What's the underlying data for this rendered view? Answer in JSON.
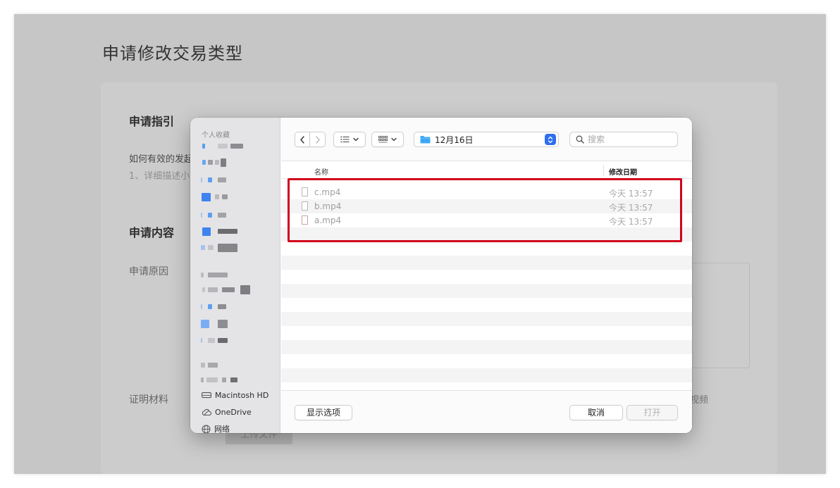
{
  "page": {
    "title": "申请修改交易类型",
    "guide_heading": "申请指引",
    "guide_text": "如何有效的发起",
    "guide_sub": "1、详细描述小",
    "content_heading": "申请内容",
    "reason_label": "申请原因",
    "proof_label": "证明材料",
    "proof_right_text": "视频",
    "upload_button": "上传文件"
  },
  "dialog": {
    "sidebar": {
      "favorites_title": "个人收藏",
      "devices": [
        {
          "label": "Macintosh HD",
          "icon": "disk-icon"
        },
        {
          "label": "OneDrive",
          "icon": "cloud-icon"
        },
        {
          "label": "网络",
          "icon": "network-icon"
        }
      ]
    },
    "toolbar": {
      "current_folder": "12月16日",
      "search_placeholder": "搜索"
    },
    "columns": {
      "name": "名称",
      "date": "修改日期"
    },
    "files": [
      {
        "name": "c.mp4",
        "date": "今天 13:57"
      },
      {
        "name": "b.mp4",
        "date": "今天 13:57"
      },
      {
        "name": "a.mp4",
        "date": "今天 13:57"
      }
    ],
    "footer": {
      "options_button": "显示选项",
      "cancel_button": "取消",
      "open_button": "打开"
    }
  },
  "colors": {
    "highlight": "#d0021b",
    "accent": "#2e6ff0",
    "folder": "#3ea6f6"
  }
}
